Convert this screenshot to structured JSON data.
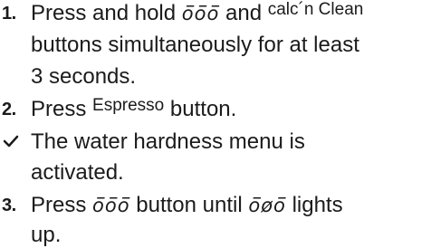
{
  "steps": [
    {
      "marker": "1.",
      "line1_a": "Press and hold",
      "line1_sym": "ō̄ō̄ō̄",
      "line1_b": "and",
      "line1_btn": "calc´n Clean",
      "line2": "buttons simultaneously for at least",
      "line3": "3 seconds."
    },
    {
      "marker": "2.",
      "text_a": "Press",
      "btn": "Espresso",
      "text_b": "button."
    },
    {
      "marker": "check-icon",
      "line1": "The water hardness menu is",
      "line2": "activated."
    },
    {
      "marker": "3.",
      "text_a": "Press",
      "sym1": "ō̄ō̄ō̄",
      "text_b": "button until",
      "sym2": "ō̄øō̄",
      "text_c": "lights",
      "line2": "up."
    }
  ]
}
